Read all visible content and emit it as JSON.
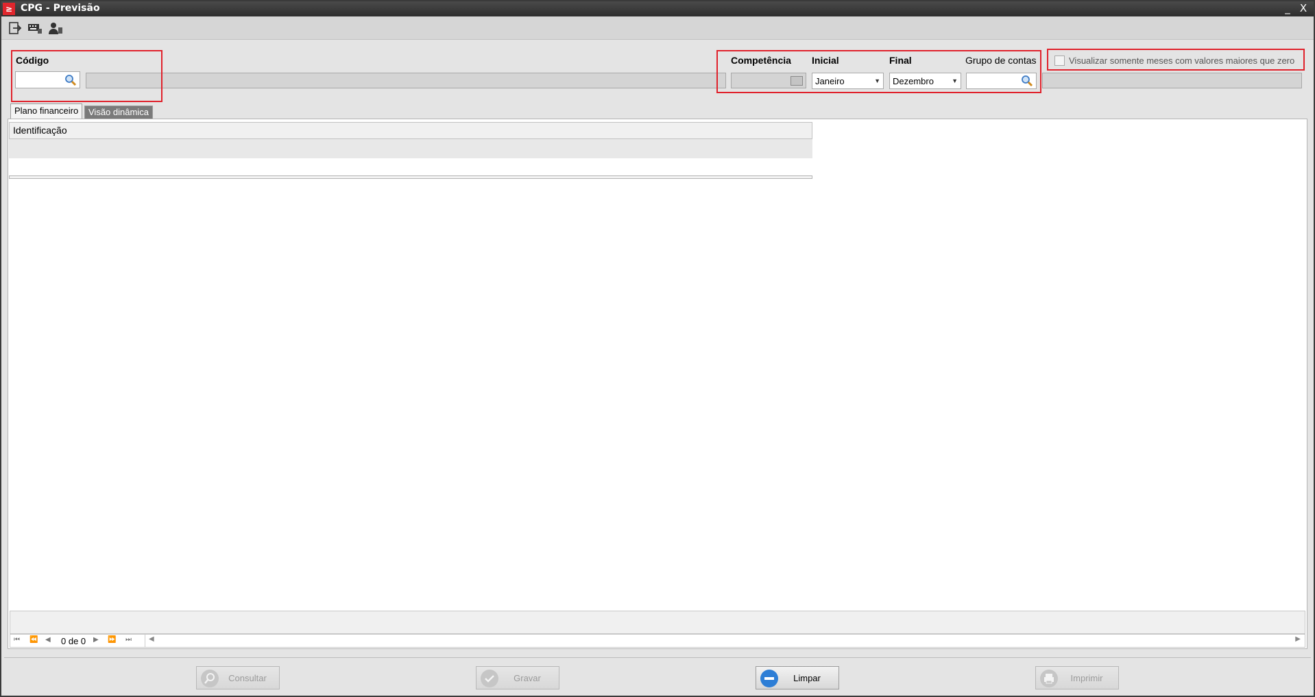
{
  "window": {
    "app_icon": "app-logo-icon",
    "title": "CPG - Previsão",
    "minimize": "_",
    "close": "X"
  },
  "toolbar": {
    "icons": [
      "exit-icon",
      "keyboard-icon",
      "user-icon"
    ]
  },
  "filters": {
    "codigo_label": "Código",
    "codigo_value": "",
    "descricao_value": "",
    "competencia_label": "Competência",
    "competencia_value": "",
    "inicial_label": "Inicial",
    "inicial_value": "Janeiro",
    "final_label": "Final",
    "final_value": "Dezembro",
    "grupo_label": "Grupo de contas",
    "grupo_value": "",
    "grupo_desc_value": "",
    "checkbox_label": "Visualizar somente meses com valores maiores que zero",
    "checkbox_checked": false,
    "highlight_color": "#e0212b"
  },
  "tabs": [
    {
      "label": "Plano financeiro",
      "active": true
    },
    {
      "label": "Visão dinâmica",
      "active": false
    }
  ],
  "grid": {
    "columns": [
      "Identificação"
    ],
    "rows": []
  },
  "navigator": {
    "record_text": "0 de 0"
  },
  "buttons": {
    "consultar": {
      "label": "Consultar",
      "enabled": false
    },
    "gravar": {
      "label": "Gravar",
      "enabled": false
    },
    "limpar": {
      "label": "Limpar",
      "enabled": true
    },
    "imprimir": {
      "label": "Imprimir",
      "enabled": false
    }
  }
}
